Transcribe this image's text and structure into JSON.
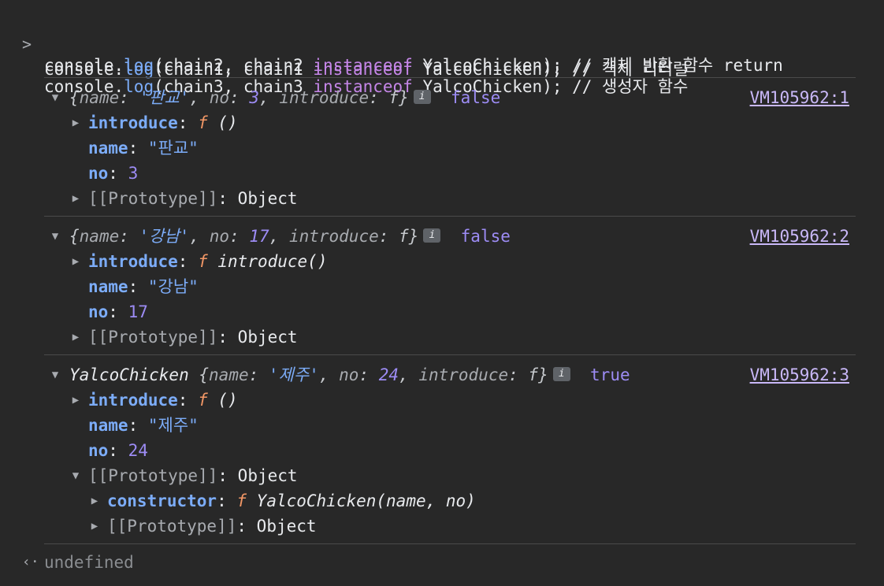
{
  "input": {
    "prompt_icon": "chevron-right-icon",
    "lines": [
      {
        "pre": "console.",
        "method": "log",
        "args_a": "(chain1, chain1 ",
        "kw": "instanceof",
        "args_b": " YalcoChicken); // 객체 리터럴"
      },
      {
        "pre": "console.",
        "method": "log",
        "args_a": "(chain2, chain2 ",
        "kw": "instanceof",
        "args_b": " YalcoChicken); // 객체 반환 함수 return"
      },
      {
        "pre": "console.",
        "method": "log",
        "args_a": "(chain3, chain3 ",
        "kw": "instanceof",
        "args_b": " YalcoChicken); // 생성자 함수"
      }
    ]
  },
  "entries": [
    {
      "preview_open": "{",
      "preview_class": "",
      "k1": "name",
      "v1": "'판교'",
      "k2": "no",
      "v2": "3",
      "k3": "introduce",
      "v3": "f",
      "preview_close": "}",
      "badge": "i",
      "bool": "false",
      "source": "VM105962:1",
      "props": {
        "introduce_key": "introduce",
        "introduce_f": "f",
        "introduce_sig": " ()",
        "name_key": "name",
        "name_val": "\"판교\"",
        "no_key": "no",
        "no_val": "3",
        "proto_key": "[[Prototype]]",
        "proto_val": "Object"
      }
    },
    {
      "preview_open": "{",
      "preview_class": "",
      "k1": "name",
      "v1": "'강남'",
      "k2": "no",
      "v2": "17",
      "k3": "introduce",
      "v3": "f",
      "preview_close": "}",
      "badge": "i",
      "bool": "false",
      "source": "VM105962:2",
      "props": {
        "introduce_key": "introduce",
        "introduce_f": "f",
        "introduce_sig": " introduce()",
        "name_key": "name",
        "name_val": "\"강남\"",
        "no_key": "no",
        "no_val": "17",
        "proto_key": "[[Prototype]]",
        "proto_val": "Object"
      }
    },
    {
      "preview_open": "{",
      "preview_class": "YalcoChicken ",
      "k1": "name",
      "v1": "'제주'",
      "k2": "no",
      "v2": "24",
      "k3": "introduce",
      "v3": "f",
      "preview_close": "}",
      "badge": "i",
      "bool": "true",
      "source": "VM105962:3",
      "props": {
        "introduce_key": "introduce",
        "introduce_f": "f",
        "introduce_sig": " ()",
        "name_key": "name",
        "name_val": "\"제주\"",
        "no_key": "no",
        "no_val": "24",
        "proto_key": "[[Prototype]]",
        "proto_val": "Object",
        "ctor_key": "constructor",
        "ctor_f": "f",
        "ctor_sig": " YalcoChicken(name, no)",
        "inner_proto_key": "[[Prototype]]",
        "inner_proto_val": "Object"
      }
    }
  ],
  "result": {
    "icon": "return-arrow-icon",
    "text": "undefined"
  }
}
